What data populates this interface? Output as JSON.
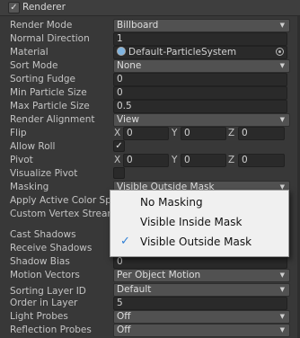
{
  "header": {
    "title": "Renderer",
    "enabled_mark": "✓"
  },
  "rows": {
    "render_mode": {
      "label": "Render Mode",
      "value": "Billboard"
    },
    "normal_direction": {
      "label": "Normal Direction",
      "value": "1"
    },
    "material": {
      "label": "Material",
      "value": "Default-ParticleSystem"
    },
    "sort_mode": {
      "label": "Sort Mode",
      "value": "None"
    },
    "sorting_fudge": {
      "label": "Sorting Fudge",
      "value": "0"
    },
    "min_particle_size": {
      "label": "Min Particle Size",
      "value": "0"
    },
    "max_particle_size": {
      "label": "Max Particle Size",
      "value": "0.5"
    },
    "render_alignment": {
      "label": "Render Alignment",
      "value": "View"
    },
    "flip": {
      "label": "Flip",
      "x": "0",
      "y": "0",
      "z": "0"
    },
    "allow_roll": {
      "label": "Allow Roll",
      "checked": "✓"
    },
    "pivot": {
      "label": "Pivot",
      "x": "0",
      "y": "0",
      "z": "0"
    },
    "visualize_pivot": {
      "label": "Visualize Pivot"
    },
    "masking": {
      "label": "Masking",
      "value": "Visible Outside Mask"
    },
    "apply_active_color_space": {
      "label": "Apply Active Color Spa"
    },
    "custom_vertex_streams": {
      "label": "Custom Vertex Stream"
    },
    "cast_shadows": {
      "label": "Cast Shadows"
    },
    "receive_shadows": {
      "label": "Receive Shadows"
    },
    "shadow_bias": {
      "label": "Shadow Bias",
      "value": "0"
    },
    "motion_vectors": {
      "label": "Motion Vectors",
      "value": "Per Object Motion"
    },
    "sorting_layer_id": {
      "label": "Sorting Layer ID",
      "value": "Default"
    },
    "order_in_layer": {
      "label": "Order in Layer",
      "value": "5"
    },
    "light_probes": {
      "label": "Light Probes",
      "value": "Off"
    },
    "reflection_probes": {
      "label": "Reflection Probes",
      "value": "Off"
    }
  },
  "axis": {
    "x": "X",
    "y": "Y",
    "z": "Z"
  },
  "masking_menu": {
    "options": [
      "No Masking",
      "Visible Inside Mask",
      "Visible Outside Mask"
    ],
    "selected_mark": "✓",
    "selected": "Visible Outside Mask"
  },
  "icons": {
    "dropdown_arrow": "▼",
    "material_icon": "particle-material-icon",
    "object_picker": "object-picker-icon"
  }
}
